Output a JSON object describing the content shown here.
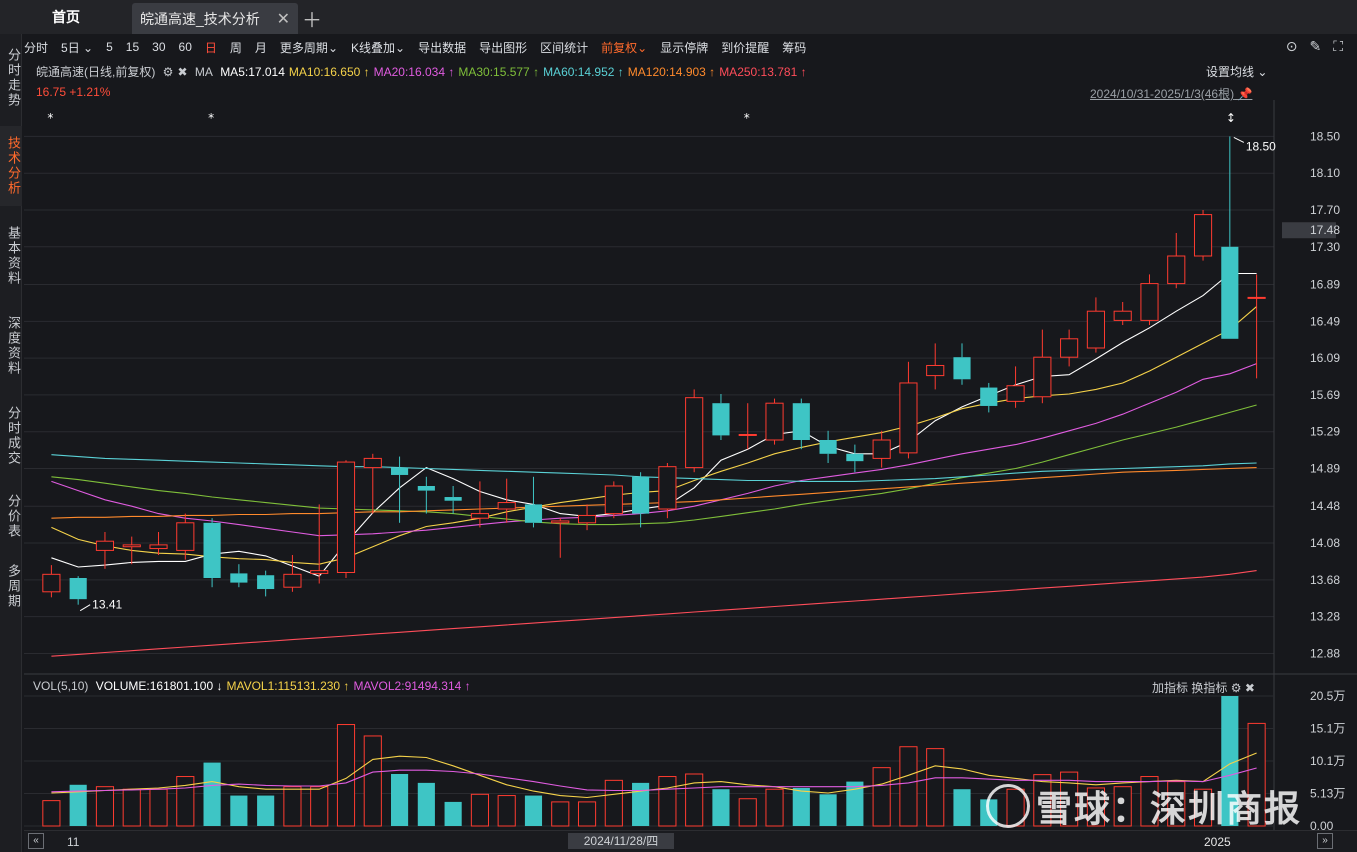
{
  "titlebar": {
    "home": "首页",
    "tab_title": "皖通高速_技术分析",
    "close": "✕",
    "new_tab": "＋"
  },
  "sidebar": [
    "分时走势",
    "技术分析",
    "基本资料",
    "深度资料",
    "分时成交",
    "分价表",
    "多周期"
  ],
  "toolbar": {
    "items": [
      "分时",
      "5日",
      "5",
      "15",
      "30",
      "60",
      "日",
      "周",
      "月",
      "更多周期",
      "K线叠加",
      "导出数据",
      "导出图形",
      "区间统计",
      "前复权",
      "显示停牌",
      "到价提醒",
      "筹码"
    ],
    "right_icons": [
      "chevron-down-icon",
      "brush-icon",
      "fullscreen-icon"
    ]
  },
  "info": {
    "name": "皖通高速(日线,前复权)",
    "ma_label": "MA",
    "ma": [
      {
        "label": "MA5:17.014",
        "color": "#ffffff"
      },
      {
        "label": "MA10:16.650",
        "arrow": "↑",
        "color": "#f5d24a"
      },
      {
        "label": "MA20:16.034",
        "arrow": "↑",
        "color": "#e05ce0"
      },
      {
        "label": "MA30:15.577",
        "arrow": "↑",
        "color": "#7fbf3a"
      },
      {
        "label": "MA60:14.952",
        "arrow": "↑",
        "color": "#5ad1d6"
      },
      {
        "label": "MA120:14.903",
        "arrow": "↑",
        "color": "#ff8a2c"
      },
      {
        "label": "MA250:13.781",
        "arrow": "↑",
        "color": "#ff4d5a"
      }
    ],
    "price": "16.75",
    "change": "+1.21%",
    "settings": "设置均线",
    "range": "2024/10/31-2025/1/3(46根)"
  },
  "chart_data": {
    "type": "candlestick",
    "ylim": [
      12.7,
      18.7
    ],
    "y_ticks": [
      "18.50",
      "18.10",
      "17.70",
      "17.30",
      "16.89",
      "16.49",
      "16.09",
      "15.69",
      "15.29",
      "14.89",
      "14.48",
      "14.08",
      "13.68",
      "13.28",
      "12.88"
    ],
    "current_price_tag": "17.48",
    "high_annotation": "18.50",
    "low_annotation": "13.41",
    "candles": [
      [
        13.55,
        13.74,
        13.49,
        13.84
      ],
      [
        13.7,
        13.47,
        13.41,
        13.72
      ],
      [
        14.0,
        14.1,
        13.8,
        14.2
      ],
      [
        14.04,
        14.06,
        13.85,
        14.15
      ],
      [
        14.02,
        14.06,
        13.95,
        14.2
      ],
      [
        14.0,
        14.3,
        13.9,
        14.4
      ],
      [
        14.3,
        13.7,
        13.6,
        14.35
      ],
      [
        13.75,
        13.65,
        13.6,
        13.85
      ],
      [
        13.73,
        13.58,
        13.5,
        13.78
      ],
      [
        13.6,
        13.74,
        13.55,
        13.95
      ],
      [
        13.75,
        13.78,
        13.64,
        14.5
      ],
      [
        13.76,
        14.96,
        13.7,
        14.98
      ],
      [
        14.9,
        15.0,
        14.4,
        15.05
      ],
      [
        14.9,
        14.82,
        14.3,
        15.02
      ],
      [
        14.7,
        14.65,
        14.4,
        14.8
      ],
      [
        14.58,
        14.54,
        14.4,
        14.7
      ],
      [
        14.35,
        14.4,
        14.25,
        14.75
      ],
      [
        14.45,
        14.52,
        14.3,
        14.78
      ],
      [
        14.5,
        14.3,
        14.25,
        14.8
      ],
      [
        14.3,
        14.32,
        13.92,
        14.35
      ],
      [
        14.3,
        14.38,
        14.22,
        14.5
      ],
      [
        14.4,
        14.7,
        14.35,
        14.75
      ],
      [
        14.8,
        14.4,
        14.25,
        14.85
      ],
      [
        14.45,
        14.91,
        14.35,
        14.95
      ],
      [
        14.9,
        15.66,
        14.85,
        15.75
      ],
      [
        15.6,
        15.25,
        15.2,
        15.7
      ],
      [
        15.25,
        15.26,
        15.1,
        15.6
      ],
      [
        15.2,
        15.6,
        15.15,
        15.65
      ],
      [
        15.6,
        15.2,
        15.1,
        15.65
      ],
      [
        15.2,
        15.05,
        14.95,
        15.3
      ],
      [
        15.05,
        14.97,
        14.85,
        15.15
      ],
      [
        15.0,
        15.2,
        14.9,
        15.3
      ],
      [
        15.06,
        15.82,
        15.0,
        16.05
      ],
      [
        15.9,
        16.01,
        15.75,
        16.25
      ],
      [
        16.1,
        15.86,
        15.8,
        16.25
      ],
      [
        15.77,
        15.57,
        15.5,
        15.82
      ],
      [
        15.62,
        15.79,
        15.55,
        16.0
      ],
      [
        15.67,
        16.1,
        15.6,
        16.4
      ],
      [
        16.1,
        16.3,
        16.0,
        16.4
      ],
      [
        16.2,
        16.6,
        16.15,
        16.75
      ],
      [
        16.5,
        16.6,
        16.45,
        16.7
      ],
      [
        16.5,
        16.9,
        16.45,
        17.0
      ],
      [
        16.9,
        17.2,
        16.85,
        17.45
      ],
      [
        17.2,
        17.65,
        17.15,
        17.7
      ],
      [
        17.3,
        16.3,
        16.3,
        18.5
      ],
      [
        16.75,
        16.75,
        15.87,
        17.0
      ]
    ],
    "ma_series": [
      {
        "name": "MA5",
        "color": "#ffffff",
        "values": [
          13.92,
          13.82,
          13.84,
          13.87,
          13.88,
          13.88,
          13.96,
          13.99,
          13.94,
          13.83,
          13.72,
          14.08,
          14.41,
          14.68,
          14.9,
          14.78,
          14.64,
          14.55,
          14.5,
          14.4,
          14.37,
          14.4,
          14.45,
          14.49,
          14.68,
          14.98,
          15.1,
          15.26,
          15.3,
          15.13,
          15.05,
          15.05,
          15.18,
          15.41,
          15.56,
          15.68,
          15.8,
          15.89,
          15.91,
          16.08,
          16.26,
          16.42,
          16.6,
          16.77,
          17.01,
          17.01
        ]
      },
      {
        "name": "MA10",
        "color": "#f5d24a",
        "values": [
          14.25,
          14.12,
          14.05,
          14.0,
          13.97,
          13.96,
          13.93,
          13.91,
          13.9,
          13.87,
          13.85,
          13.92,
          14.04,
          14.16,
          14.26,
          14.3,
          14.35,
          14.42,
          14.47,
          14.52,
          14.56,
          14.6,
          14.63,
          14.65,
          14.76,
          14.86,
          14.95,
          15.05,
          15.12,
          15.18,
          15.23,
          15.28,
          15.35,
          15.44,
          15.54,
          15.6,
          15.65,
          15.68,
          15.7,
          15.75,
          15.82,
          15.95,
          16.1,
          16.25,
          16.4,
          16.65
        ]
      },
      {
        "name": "MA20",
        "color": "#e05ce0",
        "values": [
          14.75,
          14.65,
          14.55,
          14.48,
          14.4,
          14.35,
          14.32,
          14.28,
          14.24,
          14.2,
          14.16,
          14.17,
          14.18,
          14.2,
          14.22,
          14.25,
          14.28,
          14.31,
          14.33,
          14.35,
          14.36,
          14.38,
          14.4,
          14.43,
          14.48,
          14.55,
          14.62,
          14.7,
          14.76,
          14.8,
          14.84,
          14.88,
          14.93,
          14.99,
          15.05,
          15.1,
          15.15,
          15.22,
          15.3,
          15.38,
          15.48,
          15.6,
          15.72,
          15.86,
          15.92,
          16.03
        ]
      },
      {
        "name": "MA30",
        "color": "#7fbf3a",
        "values": [
          14.8,
          14.77,
          14.73,
          14.69,
          14.65,
          14.62,
          14.58,
          14.55,
          14.52,
          14.49,
          14.46,
          14.45,
          14.44,
          14.43,
          14.42,
          14.4,
          14.37,
          14.34,
          14.31,
          14.29,
          14.28,
          14.28,
          14.29,
          14.3,
          14.33,
          14.37,
          14.41,
          14.45,
          14.5,
          14.54,
          14.58,
          14.62,
          14.67,
          14.73,
          14.79,
          14.84,
          14.89,
          14.96,
          15.04,
          15.12,
          15.2,
          15.27,
          15.34,
          15.42,
          15.5,
          15.58
        ]
      },
      {
        "name": "MA60",
        "color": "#5ad1d6",
        "values": [
          15.04,
          15.02,
          15.0,
          14.99,
          14.98,
          14.97,
          14.96,
          14.95,
          14.94,
          14.93,
          14.92,
          14.91,
          14.91,
          14.9,
          14.89,
          14.88,
          14.87,
          14.86,
          14.85,
          14.84,
          14.83,
          14.82,
          14.8,
          14.79,
          14.78,
          14.77,
          14.76,
          14.76,
          14.75,
          14.75,
          14.75,
          14.76,
          14.77,
          14.78,
          14.8,
          14.82,
          14.84,
          14.86,
          14.87,
          14.88,
          14.89,
          14.9,
          14.91,
          14.92,
          14.94,
          14.95
        ]
      },
      {
        "name": "MA120",
        "color": "#ff8a2c",
        "values": [
          14.35,
          14.36,
          14.36,
          14.37,
          14.37,
          14.38,
          14.38,
          14.39,
          14.39,
          14.4,
          14.4,
          14.41,
          14.42,
          14.42,
          14.43,
          14.44,
          14.45,
          14.46,
          14.47,
          14.48,
          14.49,
          14.5,
          14.51,
          14.52,
          14.53,
          14.55,
          14.57,
          14.59,
          14.61,
          14.63,
          14.65,
          14.67,
          14.69,
          14.71,
          14.73,
          14.75,
          14.77,
          14.79,
          14.81,
          14.83,
          14.85,
          14.86,
          14.87,
          14.88,
          14.89,
          14.9
        ]
      },
      {
        "name": "MA250",
        "color": "#ff4d5a",
        "values": [
          12.85,
          12.87,
          12.89,
          12.91,
          12.93,
          12.95,
          12.97,
          12.99,
          13.01,
          13.03,
          13.05,
          13.07,
          13.09,
          13.11,
          13.13,
          13.15,
          13.17,
          13.19,
          13.21,
          13.23,
          13.25,
          13.27,
          13.29,
          13.31,
          13.33,
          13.35,
          13.37,
          13.39,
          13.41,
          13.43,
          13.45,
          13.47,
          13.49,
          13.51,
          13.53,
          13.55,
          13.57,
          13.59,
          13.61,
          13.63,
          13.65,
          13.67,
          13.69,
          13.71,
          13.74,
          13.78
        ]
      }
    ],
    "volume": {
      "label": "VOL(5,10)",
      "items": [
        {
          "label": "VOLUME:161801.100",
          "arrow": "↓",
          "color": "#ffffff"
        },
        {
          "label": "MAVOL1:115131.230",
          "arrow": "↑",
          "color": "#f5d24a"
        },
        {
          "label": "MAVOL2:91494.314",
          "arrow": "↑",
          "color": "#e05ce0"
        }
      ],
      "y_ticks": [
        "20.5万",
        "15.1万",
        "10.1万",
        "5.13万",
        "0.00"
      ],
      "ylim": [
        0,
        205000
      ],
      "values": [
        40000,
        65000,
        62000,
        58000,
        58000,
        78000,
        100000,
        48000,
        48000,
        62000,
        62000,
        160000,
        142000,
        82000,
        68000,
        38000,
        50000,
        48000,
        48000,
        38000,
        38000,
        72000,
        68000,
        78000,
        82000,
        58000,
        43000,
        58000,
        60000,
        50000,
        70000,
        92000,
        125000,
        122000,
        58000,
        42000,
        58000,
        81000,
        85000,
        60000,
        62000,
        78000,
        70000,
        58000,
        205000,
        161801
      ],
      "mavol1": [
        52000,
        54000,
        56000,
        58000,
        60000,
        64000,
        70000,
        62000,
        58000,
        58000,
        58000,
        75000,
        105000,
        110000,
        108000,
        95000,
        80000,
        65000,
        55000,
        48000,
        45000,
        50000,
        55000,
        60000,
        68000,
        70000,
        65000,
        62000,
        55000,
        52000,
        58000,
        66000,
        80000,
        95000,
        90000,
        80000,
        75000,
        70000,
        68000,
        65000,
        68000,
        70000,
        72000,
        70000,
        98000,
        115131
      ],
      "mavol2": [
        54000,
        55000,
        56000,
        57000,
        58000,
        60000,
        64000,
        66000,
        64000,
        63000,
        63000,
        68000,
        85000,
        88000,
        88000,
        86000,
        82000,
        76000,
        70000,
        63000,
        57000,
        56000,
        56000,
        58000,
        60000,
        62000,
        62000,
        62000,
        62000,
        62000,
        62000,
        64000,
        68000,
        76000,
        76000,
        74000,
        72000,
        72000,
        72000,
        70000,
        70000,
        70000,
        71000,
        70000,
        80000,
        91494
      ]
    },
    "x_labels": {
      "left": "11",
      "cursor": "2024/11/28/四",
      "right": "2025"
    }
  },
  "vol_tools": {
    "add": "加指标",
    "switch": "换指标"
  },
  "watermark": "雪球：深圳商报",
  "colors": {
    "up": "#ff3b30",
    "down": "#3ec5c5"
  }
}
